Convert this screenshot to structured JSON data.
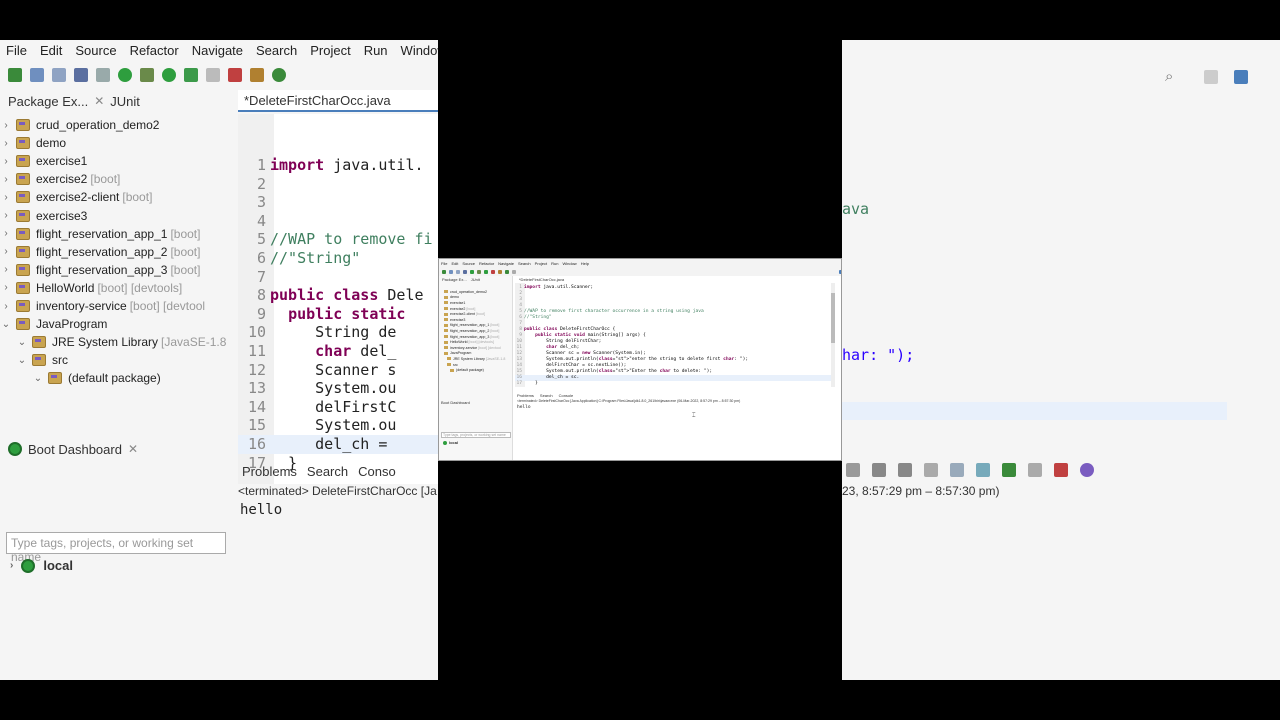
{
  "menu": [
    "File",
    "Edit",
    "Source",
    "Refactor",
    "Navigate",
    "Search",
    "Project",
    "Run",
    "Window",
    "Help"
  ],
  "package_explorer": {
    "tab_label": "Package Ex...",
    "junit_tab": "JUnit",
    "mini_tab_label": "Package Ex...",
    "projects": [
      {
        "name": "crud_operation_demo2",
        "suffix": ""
      },
      {
        "name": "demo",
        "suffix": ""
      },
      {
        "name": "exercise1",
        "suffix": ""
      },
      {
        "name": "exercise2",
        "suffix": "[boot]"
      },
      {
        "name": "exercise2-client",
        "suffix": "[boot]"
      },
      {
        "name": "exercise3",
        "suffix": ""
      },
      {
        "name": "flight_reservation_app_1",
        "suffix": "[boot]"
      },
      {
        "name": "flight_reservation_app_2",
        "suffix": "[boot]"
      },
      {
        "name": "flight_reservation_app_3",
        "suffix": "[boot]"
      },
      {
        "name": "HelloWorld",
        "suffix": "[boot] [devtools]"
      },
      {
        "name": "inventory-service",
        "suffix": "[boot] [devtool"
      },
      {
        "name": "JavaProgram",
        "suffix": ""
      },
      {
        "name": "JRE System Library",
        "suffix": "[JavaSE-1.8"
      },
      {
        "name": "src",
        "suffix": ""
      },
      {
        "name": "(default package)",
        "suffix": ""
      }
    ]
  },
  "editor": {
    "tab_label": "*DeleteFirstCharOcc.java",
    "mini_lines": [
      {
        "n": "1",
        "code": "import java.util.Scanner;"
      },
      {
        "n": "2",
        "code": ""
      },
      {
        "n": "3",
        "code": ""
      },
      {
        "n": "4",
        "code": ""
      },
      {
        "n": "5",
        "code": "//WAP to remove first character occurrence in a string using java"
      },
      {
        "n": "6",
        "code": "//\"String\""
      },
      {
        "n": "7",
        "code": ""
      },
      {
        "n": "8",
        "code": "public class DeleteFirstCharOcc {"
      },
      {
        "n": "9",
        "code": "    public static void main(String[] args) {"
      },
      {
        "n": "10",
        "code": "        String delFirstChar;"
      },
      {
        "n": "11",
        "code": "        char del_ch;"
      },
      {
        "n": "12",
        "code": "        Scanner sc = new Scanner(System.in);"
      },
      {
        "n": "13",
        "code": "        System.out.println(\"enter the string to delete first char: \");"
      },
      {
        "n": "14",
        "code": "        delFirstChar = sc.nextLine();"
      },
      {
        "n": "15",
        "code": "        System.out.println(\"Enter the char to delete: \");"
      },
      {
        "n": "16",
        "code": "        del_ch = sc."
      },
      {
        "n": "17",
        "code": "    }"
      }
    ],
    "big_lines": [
      {
        "n": "1",
        "code": "import java.util."
      },
      {
        "n": "2",
        "code": ""
      },
      {
        "n": "3",
        "code": ""
      },
      {
        "n": "4",
        "code": ""
      },
      {
        "n": "5",
        "code": "//WAP to remove fi"
      },
      {
        "n": "6",
        "code": "//\"String\""
      },
      {
        "n": "7",
        "code": ""
      },
      {
        "n": "8",
        "code": "public class Dele"
      },
      {
        "n": "9",
        "code": "  public static"
      },
      {
        "n": "10",
        "code": "     String de"
      },
      {
        "n": "11",
        "code": "     char del_"
      },
      {
        "n": "12",
        "code": "     Scanner s"
      },
      {
        "n": "13",
        "code": "     System.ou"
      },
      {
        "n": "14",
        "code": "     delFirstC"
      },
      {
        "n": "15",
        "code": "     System.ou"
      },
      {
        "n": "16",
        "code": "     del_ch = "
      },
      {
        "n": "17",
        "code": "  }"
      }
    ],
    "right_fragment_1": "ava",
    "right_fragment_2": "har: \");"
  },
  "boot_dashboard": {
    "tab_label": "Boot Dashboard",
    "filter_placeholder": "Type tags, projects, or working set name",
    "local_label": "local"
  },
  "console": {
    "problems_tab": "Problems",
    "search_tab": "Search",
    "console_tab": "Console",
    "console_tab_short": "Conso",
    "header": "<terminated> DeleteFirstCharOcc [Java Application] C:\\Program Files\\Java\\jdk1.8.0_261\\bin\\javaw.exe (06-Mar-2022, 8:57:29 pm – 8:57:30 pm)",
    "header_left": "<terminated> DeleteFirstCharOcc [Ja",
    "header_right": "23, 8:57:29 pm – 8:57:30 pm)",
    "output": "hello"
  },
  "colors": {
    "keyword": "#7f0055",
    "comment": "#3f7f5f",
    "string": "#2a00ff",
    "accent": "#4a7ebb"
  }
}
